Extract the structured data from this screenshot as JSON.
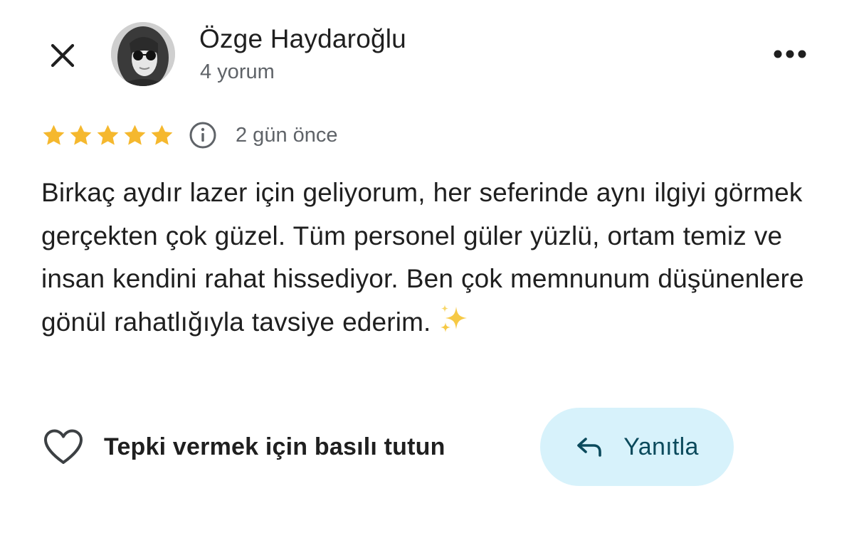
{
  "header": {
    "close_icon": "close-icon",
    "author_name": "Özge Haydaroğlu",
    "review_count": "4 yorum",
    "more_icon": "more-horiz-icon"
  },
  "rating": {
    "stars": 5,
    "max_stars": 5,
    "star_color": "#f5b82e",
    "info_icon": "info-icon",
    "date": "2 gün önce"
  },
  "review": {
    "text": "Birkaç aydır lazer için geliyorum, her seferinde aynı ilgiyi görmek gerçekten çok güzel. Tüm personel güler yüzlü, ortam temiz ve insan kendini rahat hissediyor. Ben çok memnunum düşünenlere gönül rahatlığıyla tavsiye ederim.",
    "emoji_icon": "sparkles-icon"
  },
  "actions": {
    "react_icon": "heart-outline-icon",
    "react_label": "Tepki vermek için basılı tutun",
    "reply_icon": "reply-arrow-icon",
    "reply_label": "Yanıtla",
    "reply_bg_color": "#d7f2fb",
    "reply_text_color": "#0b4a5c"
  }
}
